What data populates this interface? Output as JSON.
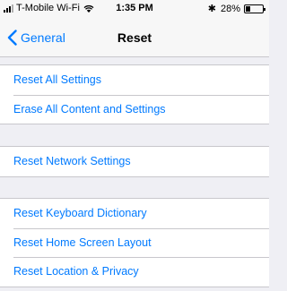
{
  "status_bar": {
    "carrier": "T-Mobile Wi-Fi",
    "time": "1:35 PM",
    "battery_percent": "28%",
    "battery_level": 0.28
  },
  "nav": {
    "back_label": "General",
    "title": "Reset"
  },
  "groups": [
    {
      "items": [
        {
          "label": "Reset All Settings"
        },
        {
          "label": "Erase All Content and Settings"
        }
      ]
    },
    {
      "items": [
        {
          "label": "Reset Network Settings"
        }
      ]
    },
    {
      "items": [
        {
          "label": "Reset Keyboard Dictionary"
        },
        {
          "label": "Reset Home Screen Layout"
        },
        {
          "label": "Reset Location & Privacy"
        }
      ]
    }
  ],
  "colors": {
    "accent": "#007aff",
    "background": "#efeff4",
    "separator": "#c8c7cc"
  }
}
